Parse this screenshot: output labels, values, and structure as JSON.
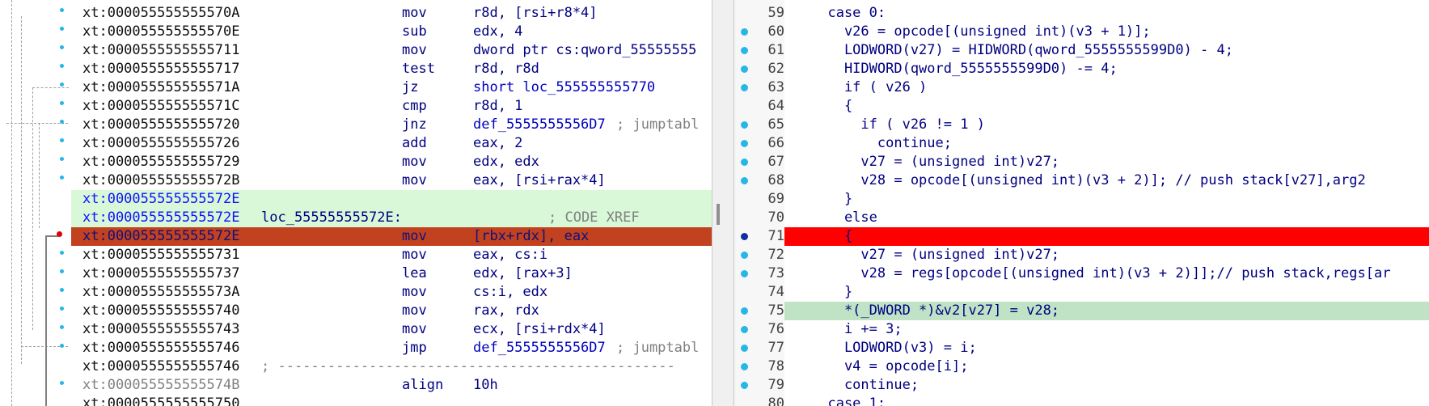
{
  "disasm": {
    "rows": [
      {
        "addr": "xt:000055555555570A",
        "label": "",
        "mnem": "mov",
        "op": "r8d, [rsi+r8*4]",
        "cmt": "",
        "hl": "",
        "addr_blue": false
      },
      {
        "addr": "xt:000055555555570E",
        "label": "",
        "mnem": "sub",
        "op": "edx, 4",
        "cmt": "",
        "hl": "",
        "addr_blue": false
      },
      {
        "addr": "xt:0000555555555711",
        "label": "",
        "mnem": "mov",
        "op": "dword ptr cs:qword_55555555",
        "cmt": "",
        "hl": "",
        "addr_blue": false
      },
      {
        "addr": "xt:0000555555555717",
        "label": "",
        "mnem": "test",
        "op": "r8d, r8d",
        "cmt": "",
        "hl": "",
        "addr_blue": false
      },
      {
        "addr": "xt:000055555555571A",
        "label": "",
        "mnem": "jz",
        "op": "short loc_555555555770",
        "cmt": "",
        "hl": "",
        "addr_blue": false
      },
      {
        "addr": "xt:000055555555571C",
        "label": "",
        "mnem": "cmp",
        "op": "r8d, 1",
        "cmt": "",
        "hl": "",
        "addr_blue": false
      },
      {
        "addr": "xt:0000555555555720",
        "label": "",
        "mnem": "jnz",
        "op": "def_5555555556D7",
        "cmt": "; jumptabl",
        "hl": "",
        "addr_blue": false
      },
      {
        "addr": "xt:0000555555555726",
        "label": "",
        "mnem": "add",
        "op": "eax, 2",
        "cmt": "",
        "hl": "",
        "addr_blue": false
      },
      {
        "addr": "xt:0000555555555729",
        "label": "",
        "mnem": "mov",
        "op": "edx, edx",
        "cmt": "",
        "hl": "",
        "addr_blue": false
      },
      {
        "addr": "xt:000055555555572B",
        "label": "",
        "mnem": "mov",
        "op": "eax, [rsi+rax*4]",
        "cmt": "",
        "hl": "",
        "addr_blue": false
      },
      {
        "addr": "xt:000055555555572E",
        "label": "",
        "mnem": "",
        "op": "",
        "cmt": "",
        "hl": "green",
        "addr_blue": true
      },
      {
        "addr": "xt:000055555555572E",
        "label": "loc_55555555572E:",
        "mnem": "",
        "op": "",
        "cmt": "; CODE XREF",
        "hl": "green",
        "addr_blue": true
      },
      {
        "addr": "xt:000055555555572E",
        "label": "",
        "mnem": "mov",
        "op": "[rbx+rdx], eax",
        "cmt": "",
        "hl": "red",
        "addr_blue": true
      },
      {
        "addr": "xt:0000555555555731",
        "label": "",
        "mnem": "mov",
        "op": "eax, cs:i",
        "cmt": "",
        "hl": "",
        "addr_blue": false
      },
      {
        "addr": "xt:0000555555555737",
        "label": "",
        "mnem": "lea",
        "op": "edx, [rax+3]",
        "cmt": "",
        "hl": "",
        "addr_blue": false
      },
      {
        "addr": "xt:000055555555573A",
        "label": "",
        "mnem": "mov",
        "op": "cs:i, edx",
        "cmt": "",
        "hl": "",
        "addr_blue": false
      },
      {
        "addr": "xt:0000555555555740",
        "label": "",
        "mnem": "mov",
        "op": "rax, rdx",
        "cmt": "",
        "hl": "",
        "addr_blue": false
      },
      {
        "addr": "xt:0000555555555743",
        "label": "",
        "mnem": "mov",
        "op": "ecx, [rsi+rdx*4]",
        "cmt": "",
        "hl": "",
        "addr_blue": false
      },
      {
        "addr": "xt:0000555555555746",
        "label": "",
        "mnem": "jmp",
        "op": "def_5555555556D7",
        "cmt": "; jumptabl",
        "hl": "",
        "addr_blue": false
      },
      {
        "addr": "xt:0000555555555746",
        "label": "",
        "mnem": "",
        "op": "",
        "cmt": "",
        "sep": "; ------------------------------------------------",
        "hl": "",
        "addr_blue": false
      },
      {
        "addr": "xt:000055555555574B",
        "label": "",
        "mnem": "align",
        "op": "10h",
        "cmt": "",
        "hl": "",
        "addr_blue": false,
        "gray": true
      },
      {
        "addr": "xt:0000555555555750",
        "label": "",
        "mnem": "",
        "op": "",
        "cmt": "",
        "hl": "",
        "addr_blue": false
      }
    ]
  },
  "pseudo": {
    "rows": [
      {
        "num": "59",
        "bp": "",
        "hl": "",
        "code": "  case 0:"
      },
      {
        "num": "60",
        "bp": "cyan",
        "hl": "",
        "code": "    v26 = opcode[(unsigned int)(v3 + 1)];"
      },
      {
        "num": "61",
        "bp": "cyan",
        "hl": "",
        "code": "    LODWORD(v27) = HIDWORD(qword_5555555599D0) - 4;"
      },
      {
        "num": "62",
        "bp": "cyan",
        "hl": "",
        "code": "    HIDWORD(qword_5555555599D0) -= 4;"
      },
      {
        "num": "63",
        "bp": "cyan",
        "hl": "",
        "code": "    if ( v26 )"
      },
      {
        "num": "64",
        "bp": "",
        "hl": "",
        "code": "    {"
      },
      {
        "num": "65",
        "bp": "cyan",
        "hl": "",
        "code": "      if ( v26 != 1 )"
      },
      {
        "num": "66",
        "bp": "cyan",
        "hl": "",
        "code": "        continue;"
      },
      {
        "num": "67",
        "bp": "cyan",
        "hl": "",
        "code": "      v27 = (unsigned int)v27;"
      },
      {
        "num": "68",
        "bp": "cyan",
        "hl": "",
        "code": "      v28 = opcode[(unsigned int)(v3 + 2)]; // push stack[v27],arg2"
      },
      {
        "num": "69",
        "bp": "",
        "hl": "",
        "code": "    }"
      },
      {
        "num": "70",
        "bp": "",
        "hl": "",
        "code": "    else"
      },
      {
        "num": "71",
        "bp": "navy",
        "hl": "red",
        "code": "    {"
      },
      {
        "num": "72",
        "bp": "cyan",
        "hl": "",
        "code": "      v27 = (unsigned int)v27;"
      },
      {
        "num": "73",
        "bp": "cyan",
        "hl": "",
        "code": "      v28 = regs[opcode[(unsigned int)(v3 + 2)]];// push stack,regs[ar"
      },
      {
        "num": "74",
        "bp": "",
        "hl": "",
        "code": "    }"
      },
      {
        "num": "75",
        "bp": "cyan",
        "hl": "green",
        "code": "    *(_DWORD *)&v2[v27] = v28;"
      },
      {
        "num": "76",
        "bp": "cyan",
        "hl": "",
        "code": "    i += 3;"
      },
      {
        "num": "77",
        "bp": "cyan",
        "hl": "",
        "code": "    LODWORD(v3) = i;"
      },
      {
        "num": "78",
        "bp": "cyan",
        "hl": "",
        "code": "    v4 = opcode[i];"
      },
      {
        "num": "79",
        "bp": "cyan",
        "hl": "",
        "code": "    continue;"
      },
      {
        "num": "80",
        "bp": "",
        "hl": "",
        "code": "  case 1:"
      }
    ]
  },
  "colors": {
    "highlight_red": "#ff0000",
    "highlight_green": "#bfe3c4",
    "disasm_current": "#c2421f",
    "disasm_block": "#d8f8d8",
    "breakpoint_dot": "#26b7e6"
  }
}
